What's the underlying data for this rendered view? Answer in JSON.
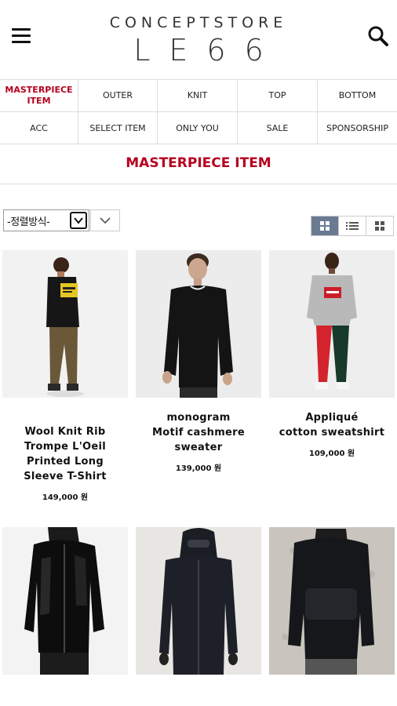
{
  "header": {
    "logo_top": "CONCEPTSTORE",
    "logo_main": "LE66"
  },
  "categories": [
    {
      "label": "MASTERPIECE\nITEM",
      "active": true
    },
    {
      "label": "OUTER"
    },
    {
      "label": "KNIT"
    },
    {
      "label": "TOP"
    },
    {
      "label": "BOTTOM"
    },
    {
      "label": "ACC"
    },
    {
      "label": "SELECT ITEM"
    },
    {
      "label": "ONLY YOU"
    },
    {
      "label": "SALE"
    },
    {
      "label": "SPONSORSHIP"
    }
  ],
  "page_title": "MASTERPIECE ITEM",
  "sort": {
    "selected": "-정렬방식-"
  },
  "colors": {
    "accent": "#b5001f",
    "view_active": "#6b7a93"
  },
  "products": [
    {
      "name": "Wool Knit Rib\nTrompe L'Oeil\nPrinted Long\nSleeve T-Shirt",
      "price": "149,000 원"
    },
    {
      "name": "monogram\nMotif cashmere\nsweater",
      "price": "139,000 원"
    },
    {
      "name": "Appliqué\ncotton sweatshirt",
      "price": "109,000 원"
    }
  ]
}
